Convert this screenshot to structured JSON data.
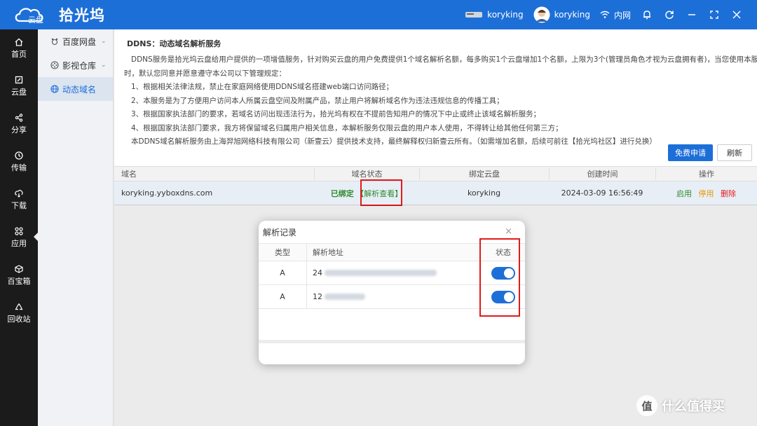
{
  "app": {
    "logo_text": "拾光坞"
  },
  "topbar": {
    "device_name": "koryking",
    "user_name": "koryking",
    "network_label": "内网"
  },
  "sidebar": {
    "items": [
      {
        "label": "首页",
        "icon": "home-icon"
      },
      {
        "label": "云盘",
        "icon": "cloud-drive-icon"
      },
      {
        "label": "分享",
        "icon": "share-icon"
      },
      {
        "label": "传输",
        "icon": "transfer-icon"
      },
      {
        "label": "下载",
        "icon": "download-icon"
      },
      {
        "label": "应用",
        "icon": "apps-icon"
      },
      {
        "label": "百宝箱",
        "icon": "toolbox-icon"
      },
      {
        "label": "回收站",
        "icon": "recycle-icon"
      }
    ]
  },
  "subnav": {
    "items": [
      {
        "label": "百度网盘",
        "icon": "baidu-icon"
      },
      {
        "label": "影视仓库",
        "icon": "film-icon"
      },
      {
        "label": "动态域名",
        "icon": "globe-icon"
      }
    ]
  },
  "ddns": {
    "title": "DDNS：动态域名解析服务",
    "lines": [
      "DDNS服务是拾光坞云盘给用户提供的一项增值服务，针对购买云盘的用户免费提供1个域名解析名额，每多购买1个云盘增加1个名额，上限为3个(管理员角色才视为云盘拥有者)，当您使用本服务",
      "时，默认您同意并愿意遵守本公司以下管理规定：",
      "1、根据相关法律法规，禁止在家庭网络使用DDNS域名搭建web端口访问路径；",
      "2、本服务是为了方便用户访问本人所属云盘空间及附属产品，禁止用户将解析域名作为违法违规信息的传播工具；",
      "3、根据国家执法部门的要求，若域名访问出现违法行为，拾光坞有权在不提前告知用户的情况下中止或终止该域名解析服务；",
      "4、根据国家执法部门要求，我方将保留域名归属用户相关信息，本解析服务仅限云盘的用户本人使用，不得转让给其他任何第三方；",
      "本DDNS域名解析服务由上海羿旭网络科技有限公司（新壹云）提供技术支持，最终解释权归新壹云所有。（如需增加名额，后续可前往【拾光坞社区】进行兑换）"
    ],
    "apply_label": "免费申请",
    "refresh_label": "刷新"
  },
  "table": {
    "headers": [
      "域名",
      "域名状态",
      "绑定云盘",
      "创建时间",
      "操作"
    ],
    "row": {
      "domain": "koryking.yyboxdns.com",
      "status": "已绑定",
      "resolve_link": "【解析查看】",
      "cloud": "koryking",
      "created": "2024-03-09 16:56:49",
      "act_enable": "启用",
      "act_disable": "停用",
      "act_delete": "删除"
    }
  },
  "modal": {
    "title": "解析记录",
    "close": "×",
    "headers": [
      "类型",
      "解析地址",
      "状态"
    ],
    "records": [
      {
        "type": "A",
        "address_prefix": "24",
        "enabled": true
      },
      {
        "type": "A",
        "address_prefix": "12",
        "enabled": true
      }
    ]
  },
  "watermark": {
    "logo": "值",
    "text": "什么值得买"
  },
  "colors": {
    "brand": "#1d6fd8",
    "highlight": "#e01b1b",
    "ok": "#2e8b2e"
  }
}
